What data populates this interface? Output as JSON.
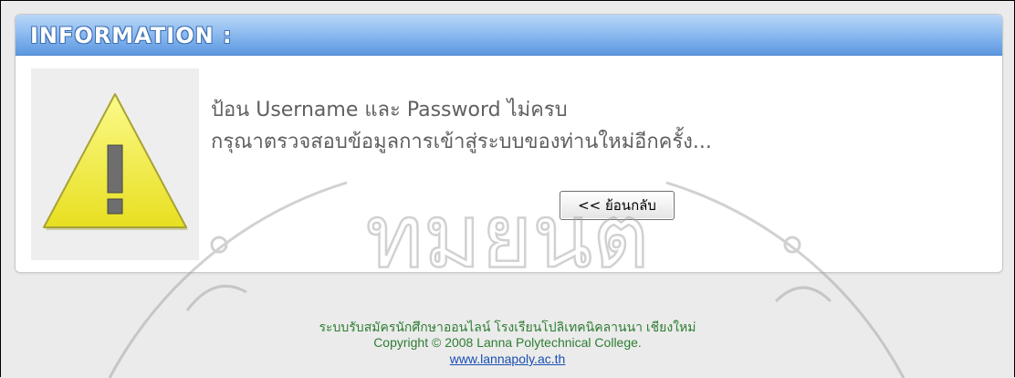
{
  "panel": {
    "title": "INFORMATION :"
  },
  "message": {
    "line1": "ป้อน Username และ Password ไม่ครบ",
    "line2": "กรุณาตรวจสอบข้อมูลการเข้าสู่ระบบของท่านใหม่อีกครั้ง..."
  },
  "back_button": {
    "label": "<< ย้อนกลับ"
  },
  "footer": {
    "system_name": "ระบบรับสมัครนักศึกษาออนไลน์ โรงเรียนโปลิเทคนิคลานนา เชียงใหม่",
    "copyright": "Copyright © 2008 Lanna Polytechnical College.",
    "link": "www.lannapoly.ac.th"
  },
  "watermark": {
    "text": "ทมยนต"
  },
  "icons": {
    "warning": "warning-triangle-icon"
  },
  "colors": {
    "header_blue": "#5c98e0",
    "warning_yellow": "#f2ec3a",
    "footer_green": "#2e7d32",
    "link_blue": "#1a4fb3"
  }
}
